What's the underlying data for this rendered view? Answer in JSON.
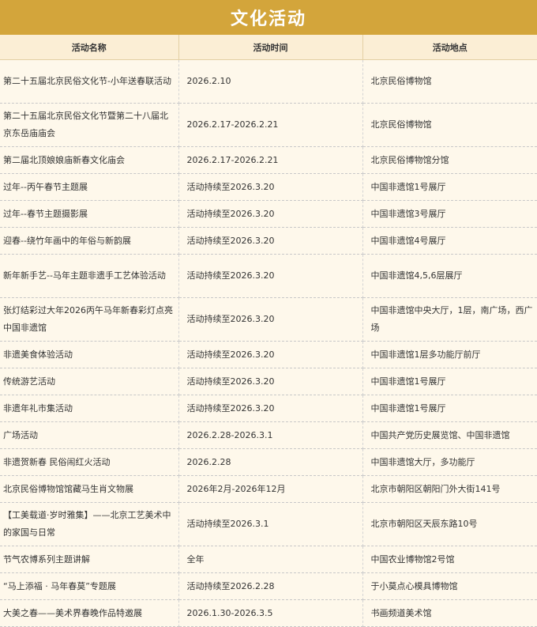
{
  "title": "文化活动",
  "headers": [
    "活动名称",
    "活动时间",
    "活动地点"
  ],
  "rows": [
    {
      "name": "第二十五届北京民俗文化节-小年送春联活动",
      "time": "2026.2.10",
      "place": "北京民俗博物馆"
    },
    {
      "name": "第二十五届北京民俗文化节暨第二十八届北京东岳庙庙会",
      "time": "2026.2.17-2026.2.21",
      "place": "北京民俗博物馆"
    },
    {
      "name": "第二届北顶娘娘庙新春文化庙会",
      "time": "2026.2.17-2026.2.21",
      "place": "北京民俗博物馆分馆"
    },
    {
      "name": "过年--丙午春节主题展",
      "time": "活动持续至2026.3.20",
      "place": "中国非遗馆1号展厅"
    },
    {
      "name": "过年--春节主题摄影展",
      "time": "活动持续至2026.3.20",
      "place": "中国非遗馆3号展厅"
    },
    {
      "name": "迎春--绕竹年画中的年俗与新韵展",
      "time": "活动持续至2026.3.20",
      "place": "中国非遗馆4号展厅"
    },
    {
      "name": "新年新手艺--马年主题非遗手工艺体验活动",
      "time": "活动持续至2026.3.20",
      "place": "中国非遗馆4,5,6层展厅"
    },
    {
      "name": "张灯结彩过大年2026丙午马年新春彩灯点亮中国非遗馆",
      "time": "活动持续至2026.3.20",
      "place": "中国非遗馆中央大厅，1层，南广场，西广场"
    },
    {
      "name": "非遗美食体验活动",
      "time": "活动持续至2026.3.20",
      "place": "中国非遗馆1层多功能厅前厅"
    },
    {
      "name": "传统游艺活动",
      "time": "活动持续至2026.3.20",
      "place": "中国非遗馆1号展厅"
    },
    {
      "name": "非遗年礼市集活动",
      "time": "活动持续至2026.3.20",
      "place": "中国非遗馆1号展厅"
    },
    {
      "name": "广场活动",
      "time": "2026.2.28-2026.3.1",
      "place": "中国共产党历史展览馆、中国非遗馆"
    },
    {
      "name": "非遗贺新春 民俗闹红火活动",
      "time": "2026.2.28",
      "place": "中国非遗馆大厅，多功能厅"
    },
    {
      "name": "北京民俗博物馆馆藏马生肖文物展",
      "time": "2026年2月-2026年12月",
      "place": "北京市朝阳区朝阳门外大街141号"
    },
    {
      "name": "【工美载道·岁时雅集】——北京工艺美术中的家国与日常",
      "time": "活动持续至2026.3.1",
      "place": "北京市朝阳区天辰东路10号"
    },
    {
      "name": "节气农博系列主题讲解",
      "time": "全年",
      "place": "中国农业博物馆2号馆"
    },
    {
      "name": "“马上添福 · 马年春莫”专题展",
      "time": "活动持续至2026.2.28",
      "place": "于小莫点心模具博物馆"
    },
    {
      "name": "大美之春——美术界春晚作品特邀展",
      "time": "2026.1.30-2026.3.5",
      "place": "书画频道美术馆"
    }
  ]
}
